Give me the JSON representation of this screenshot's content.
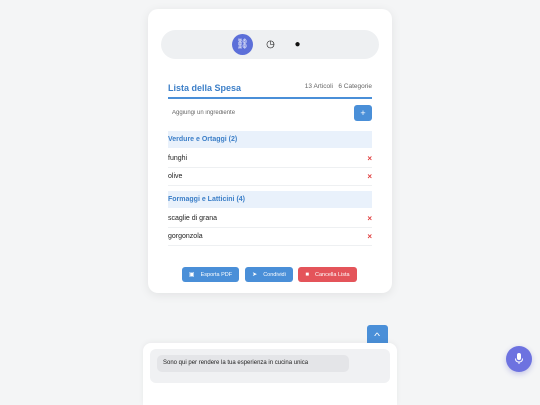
{
  "tabs": [
    {
      "icon": "basket-icon",
      "glyph": "🧺",
      "active": true
    },
    {
      "icon": "clock-icon",
      "glyph": "🕓",
      "active": false
    },
    {
      "icon": "lightbulb-icon",
      "glyph": "💡",
      "active": false
    }
  ],
  "list": {
    "title": "Lista della Spesa",
    "articles": "13 Articoli",
    "categories": "6 Categorie"
  },
  "add": {
    "placeholder": "Aggiungi un ingrediente",
    "button_label": "+"
  },
  "categories": [
    {
      "label": "Verdure e Ortaggi (2)",
      "items": [
        "funghi",
        "olive"
      ]
    },
    {
      "label": "Formaggi e Latticini (4)",
      "items": [
        "scaglie di grana",
        "gorgonzola"
      ]
    }
  ],
  "delete_glyph": "×",
  "actions": {
    "export_label": "Esporta PDF",
    "share_label": "Condividi",
    "clear_label": "Cancella Lista"
  },
  "scroll_up_glyph": "^",
  "chat": {
    "message": "Sono qui per rendere la tua esperienza in cucina unica"
  },
  "colors": {
    "accent": "#4a8fd8",
    "danger": "#e4545a",
    "tab_active": "#5c6fd9",
    "mic": "#6d72e0"
  }
}
